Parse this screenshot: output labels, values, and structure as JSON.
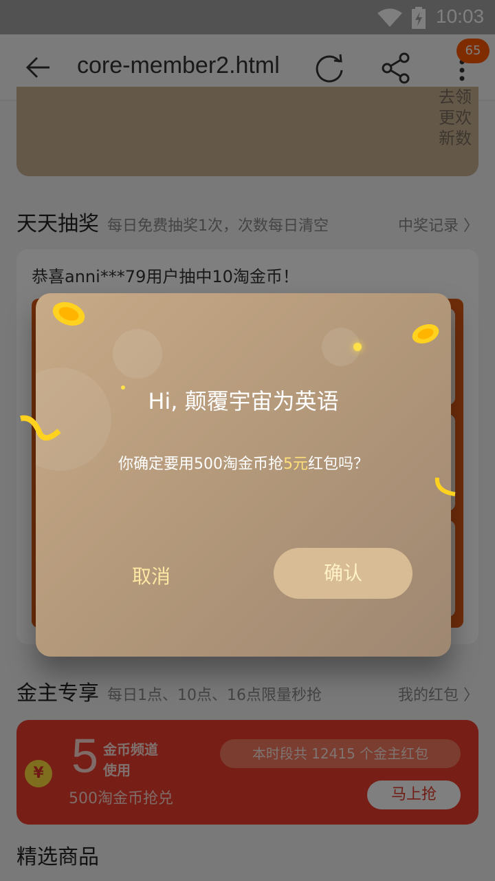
{
  "status_bar": {
    "time": "10:03"
  },
  "toolbar": {
    "title": "core-member2.html",
    "badge_count": "65"
  },
  "top_card": {
    "side_text": "去领\n更欢\n新数"
  },
  "lottery_section": {
    "heading": "天天抽奖",
    "subheading": "每日免费抽奖1次，次数每日清空",
    "link": "中奖记录 〉",
    "winner_text": "恭喜anni***79用户抽中10淘金币！"
  },
  "dialog": {
    "greeting": "Hi, 颠覆宇宙为英语",
    "message_prefix": "你确定要用500淘金币抢",
    "message_highlight": "5元",
    "message_suffix": "红包吗？",
    "cancel_label": "取消",
    "confirm_label": "确认"
  },
  "vip_section": {
    "heading": "金主专享",
    "subheading": "每日1点、10点、16点限量秒抢",
    "link": "我的红包 〉",
    "coin_symbol": "¥",
    "amount": "5",
    "desc": "金币频道使用",
    "cost": "500淘金币抢兑",
    "pool_text": "本时段共 12415 个金主红包",
    "grab_label": "马上抢"
  },
  "products": {
    "heading": "精选商品"
  }
}
